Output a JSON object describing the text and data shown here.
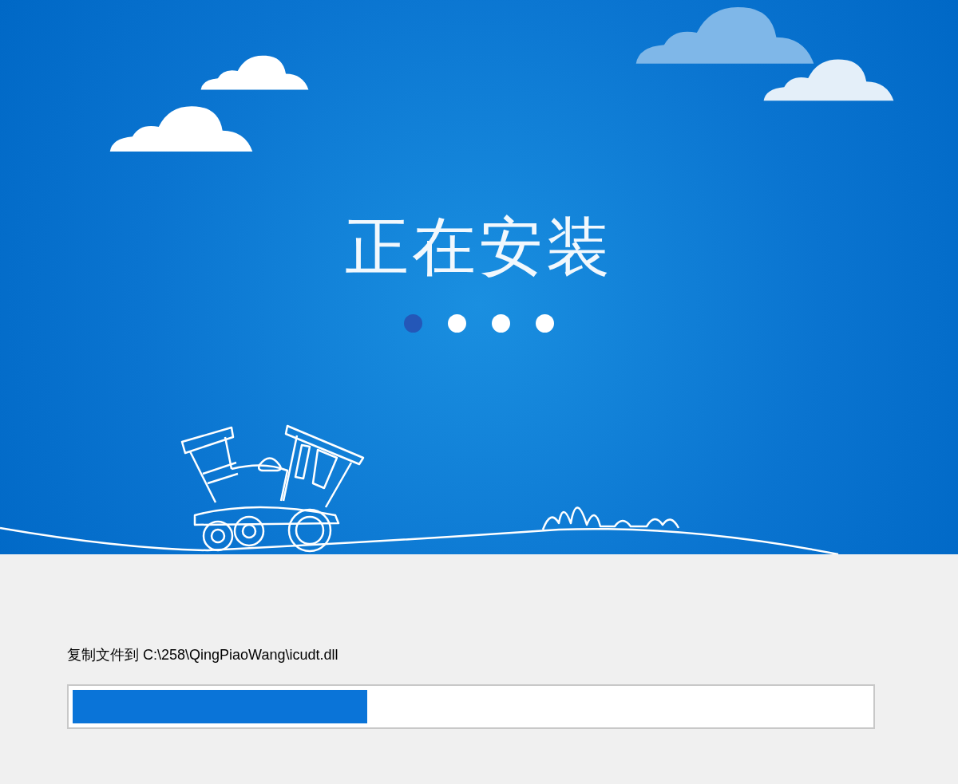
{
  "banner": {
    "title": "正在安装",
    "steps": [
      {
        "selected": true
      },
      {
        "selected": false
      },
      {
        "selected": false
      },
      {
        "selected": false
      }
    ]
  },
  "status": {
    "text": "复制文件到 C:\\258\\QingPiaoWang\\icudt.dll"
  },
  "progress": {
    "level": 0.37
  }
}
